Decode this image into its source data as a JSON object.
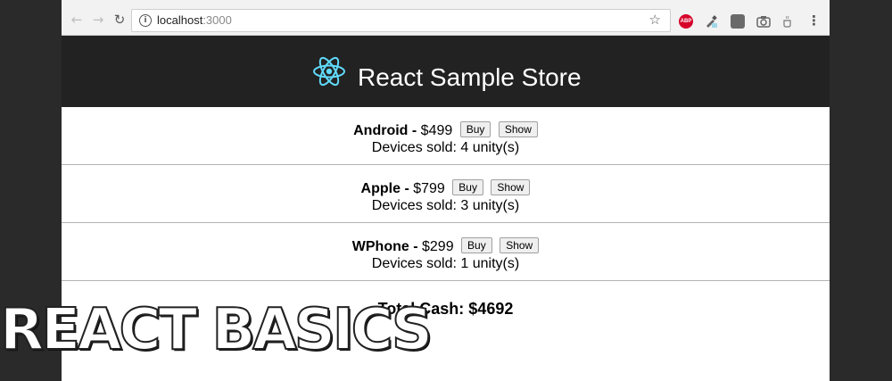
{
  "browser": {
    "url_host": "localhost",
    "url_port": ":3000",
    "back_icon": "arrow-left",
    "forward_icon": "arrow-right",
    "reload_icon": "reload",
    "extensions": [
      "adblock-plus-icon",
      "color-dropper-icon",
      "box-icon",
      "camera-icon",
      "coffee-icon"
    ]
  },
  "header": {
    "title": "React Sample Store",
    "logo": "react-atom-logo",
    "logo_color": "#61dafb"
  },
  "products": [
    {
      "name": "Android",
      "price": "$499",
      "buy_label": "Buy",
      "show_label": "Show",
      "sold_text": "Devices sold: 4 unity(s)"
    },
    {
      "name": "Apple",
      "price": "$799",
      "buy_label": "Buy",
      "show_label": "Show",
      "sold_text": "Devices sold: 3 unity(s)"
    },
    {
      "name": "WPhone",
      "price": "$299",
      "buy_label": "Buy",
      "show_label": "Show",
      "sold_text": "Devices sold: 1 unity(s)"
    }
  ],
  "separator": "-",
  "total": "Total Cash: $4692",
  "overlay_title": "REACT BASICS",
  "colors": {
    "header_bg": "#222222",
    "page_bg": "#2a2a2a"
  }
}
